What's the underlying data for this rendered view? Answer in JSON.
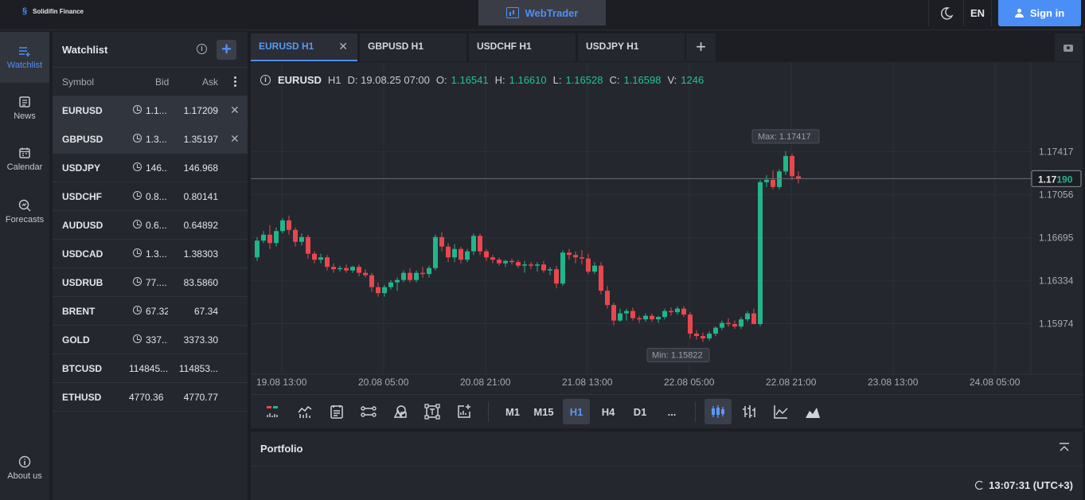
{
  "brand": {
    "name": "Solidifin Finance"
  },
  "header": {
    "center_tab": "WebTrader",
    "language": "EN",
    "sign_in": "Sign in"
  },
  "nav": [
    {
      "label": "Watchlist",
      "icon": "watchlist-icon"
    },
    {
      "label": "News",
      "icon": "news-icon"
    },
    {
      "label": "Calendar",
      "icon": "calendar-icon"
    },
    {
      "label": "Forecasts",
      "icon": "forecasts-icon"
    },
    {
      "label": "About us",
      "icon": "info-icon"
    }
  ],
  "watchlist": {
    "title": "Watchlist",
    "columns": {
      "symbol": "Symbol",
      "bid": "Bid",
      "ask": "Ask"
    },
    "rows": [
      {
        "symbol": "EURUSD",
        "bid": "1.1...",
        "ask": "1.17209",
        "clock": true,
        "removable": true
      },
      {
        "symbol": "GBPUSD",
        "bid": "1.3...",
        "ask": "1.35197",
        "clock": true,
        "removable": true
      },
      {
        "symbol": "USDJPY",
        "bid": "146...",
        "ask": "146.968",
        "clock": true
      },
      {
        "symbol": "USDCHF",
        "bid": "0.8...",
        "ask": "0.80141",
        "clock": true
      },
      {
        "symbol": "AUDUSD",
        "bid": "0.6...",
        "ask": "0.64892",
        "clock": true
      },
      {
        "symbol": "USDCAD",
        "bid": "1.3...",
        "ask": "1.38303",
        "clock": true
      },
      {
        "symbol": "USDRUB",
        "bid": "77....",
        "ask": "83.5860",
        "clock": true
      },
      {
        "symbol": "BRENT",
        "bid": "67.32",
        "ask": "67.34",
        "clock": true
      },
      {
        "symbol": "GOLD",
        "bid": "337...",
        "ask": "3373.30",
        "clock": true
      },
      {
        "symbol": "BTCUSD",
        "bid": "114845...",
        "ask": "114853...",
        "clock": false
      },
      {
        "symbol": "ETHUSD",
        "bid": "4770.36",
        "ask": "4770.77",
        "clock": false
      }
    ]
  },
  "tabs": [
    "EURUSD H1",
    "GBPUSD H1",
    "USDCHF H1",
    "USDJPY H1"
  ],
  "ohlc": {
    "pair": "EURUSD",
    "tf": "H1",
    "date_label": "D: 19.08.25 07:00",
    "o_label": "O:",
    "o": "1.16541",
    "h_label": "H:",
    "h": "1.16610",
    "l_label": "L:",
    "l": "1.16528",
    "c_label": "C:",
    "c": "1.16598",
    "v_label": "V:",
    "v": "1246"
  },
  "colors": {
    "up": "#22b58a",
    "down": "#e9474e",
    "accent": "#4f8ff7"
  },
  "timeframes": [
    "M1",
    "M15",
    "H1",
    "H4",
    "D1",
    "..."
  ],
  "selected_timeframe": "H1",
  "portfolio": {
    "title": "Portfolio",
    "clock": "13:07:31 (UTC+3)"
  },
  "chart_data": {
    "type": "candlestick",
    "symbol": "EURUSD",
    "timeframe": "H1",
    "x_ticks": [
      "19.08 13:00",
      "20.08 05:00",
      "20.08 21:00",
      "21.08 13:00",
      "22.08 05:00",
      "22.08 21:00",
      "23.08 13:00",
      "24.08 05:00"
    ],
    "y_ticks": [
      "1.17417",
      "1.17056",
      "1.16695",
      "1.16334",
      "1.15974"
    ],
    "ylim": [
      1.1555,
      1.179
    ],
    "current_price": {
      "prefix": "1.17",
      "suffix": "190",
      "value": 1.1719
    },
    "max_label": "Max: 1.17417",
    "min_label": "Min: 1.15822",
    "candles": [
      [
        1.1653,
        1.167,
        1.165,
        1.1667
      ],
      [
        1.1667,
        1.1675,
        1.1665,
        1.1672
      ],
      [
        1.1672,
        1.168,
        1.166,
        1.1665
      ],
      [
        1.1665,
        1.1678,
        1.1662,
        1.1675
      ],
      [
        1.1675,
        1.1686,
        1.1673,
        1.1684
      ],
      [
        1.1684,
        1.1688,
        1.1672,
        1.1676
      ],
      [
        1.1676,
        1.1678,
        1.1662,
        1.1666
      ],
      [
        1.1666,
        1.1673,
        1.1663,
        1.167
      ],
      [
        1.167,
        1.1672,
        1.1652,
        1.1656
      ],
      [
        1.1656,
        1.1658,
        1.1648,
        1.1651
      ],
      [
        1.1651,
        1.1656,
        1.1648,
        1.1653
      ],
      [
        1.1653,
        1.1655,
        1.1642,
        1.1645
      ],
      [
        1.1645,
        1.1648,
        1.164,
        1.1643
      ],
      [
        1.1643,
        1.1646,
        1.1641,
        1.1644
      ],
      [
        1.1644,
        1.1647,
        1.164,
        1.1642
      ],
      [
        1.1642,
        1.1646,
        1.164,
        1.1645
      ],
      [
        1.1645,
        1.1647,
        1.1637,
        1.164
      ],
      [
        1.164,
        1.1643,
        1.1636,
        1.1638
      ],
      [
        1.1638,
        1.164,
        1.1624,
        1.1628
      ],
      [
        1.1628,
        1.1632,
        1.162,
        1.1623
      ],
      [
        1.1623,
        1.163,
        1.162,
        1.1628
      ],
      [
        1.1628,
        1.1634,
        1.1626,
        1.1632
      ],
      [
        1.1632,
        1.1636,
        1.1625,
        1.1634
      ],
      [
        1.1634,
        1.1642,
        1.1632,
        1.164
      ],
      [
        1.164,
        1.1644,
        1.1632,
        1.1634
      ],
      [
        1.1634,
        1.1642,
        1.1632,
        1.164
      ],
      [
        1.164,
        1.1645,
        1.1636,
        1.1639
      ],
      [
        1.1639,
        1.1646,
        1.1636,
        1.1644
      ],
      [
        1.1644,
        1.1672,
        1.1642,
        1.167
      ],
      [
        1.167,
        1.1674,
        1.1658,
        1.1662
      ],
      [
        1.1662,
        1.1665,
        1.1649,
        1.1653
      ],
      [
        1.1653,
        1.1664,
        1.1649,
        1.166
      ],
      [
        1.166,
        1.1662,
        1.1648,
        1.1651
      ],
      [
        1.1651,
        1.166,
        1.1649,
        1.1658
      ],
      [
        1.1658,
        1.1673,
        1.1655,
        1.1671
      ],
      [
        1.1671,
        1.1673,
        1.1655,
        1.1658
      ],
      [
        1.1658,
        1.166,
        1.165,
        1.1653
      ],
      [
        1.1653,
        1.1655,
        1.1648,
        1.1651
      ],
      [
        1.1651,
        1.1653,
        1.1646,
        1.1648
      ],
      [
        1.1648,
        1.1651,
        1.1645,
        1.165
      ],
      [
        1.165,
        1.1652,
        1.1647,
        1.1649
      ],
      [
        1.1649,
        1.1651,
        1.1644,
        1.1646
      ],
      [
        1.1646,
        1.165,
        1.164,
        1.1647
      ],
      [
        1.1647,
        1.1649,
        1.1643,
        1.1646
      ],
      [
        1.1646,
        1.1649,
        1.1641,
        1.1647
      ],
      [
        1.1647,
        1.165,
        1.164,
        1.1642
      ],
      [
        1.1642,
        1.1645,
        1.1638,
        1.1643
      ],
      [
        1.1643,
        1.1646,
        1.1627,
        1.1631
      ],
      [
        1.1631,
        1.1659,
        1.1629,
        1.1657
      ],
      [
        1.1657,
        1.166,
        1.1651,
        1.1655
      ],
      [
        1.1655,
        1.1658,
        1.1648,
        1.1653
      ],
      [
        1.1653,
        1.1659,
        1.1647,
        1.1652
      ],
      [
        1.1652,
        1.1656,
        1.1639,
        1.1641
      ],
      [
        1.1641,
        1.1649,
        1.1639,
        1.1646
      ],
      [
        1.1646,
        1.1649,
        1.1622,
        1.1625
      ],
      [
        1.1625,
        1.1629,
        1.161,
        1.1613
      ],
      [
        1.1613,
        1.1615,
        1.1596,
        1.16
      ],
      [
        1.16,
        1.161,
        1.1599,
        1.1606
      ],
      [
        1.1606,
        1.161,
        1.16,
        1.1608
      ],
      [
        1.1608,
        1.1611,
        1.16,
        1.1602
      ],
      [
        1.1602,
        1.1604,
        1.1598,
        1.1601
      ],
      [
        1.1601,
        1.1606,
        1.1599,
        1.1604
      ],
      [
        1.1604,
        1.1606,
        1.1599,
        1.1601
      ],
      [
        1.1601,
        1.1604,
        1.1598,
        1.1603
      ],
      [
        1.1603,
        1.161,
        1.1601,
        1.1608
      ],
      [
        1.1608,
        1.1611,
        1.1604,
        1.1607
      ],
      [
        1.1607,
        1.1612,
        1.1605,
        1.161
      ],
      [
        1.161,
        1.1612,
        1.1603,
        1.1605
      ],
      [
        1.1605,
        1.1607,
        1.1585,
        1.1589
      ],
      [
        1.1589,
        1.1592,
        1.1584,
        1.1587
      ],
      [
        1.1587,
        1.159,
        1.1582,
        1.1585
      ],
      [
        1.1585,
        1.1591,
        1.1583,
        1.1589
      ],
      [
        1.1589,
        1.1595,
        1.1587,
        1.1594
      ],
      [
        1.1594,
        1.16,
        1.1592,
        1.1598
      ],
      [
        1.1598,
        1.1602,
        1.1595,
        1.1597
      ],
      [
        1.1597,
        1.16,
        1.1593,
        1.1595
      ],
      [
        1.1595,
        1.1603,
        1.1593,
        1.1601
      ],
      [
        1.1601,
        1.1608,
        1.1599,
        1.1606
      ],
      [
        1.1606,
        1.161,
        1.1599,
        1.1597
      ],
      [
        1.1597,
        1.1718,
        1.1595,
        1.1716
      ],
      [
        1.1716,
        1.1722,
        1.1712,
        1.1718
      ],
      [
        1.1718,
        1.1726,
        1.171,
        1.1712
      ],
      [
        1.1712,
        1.1727,
        1.171,
        1.1725
      ],
      [
        1.1725,
        1.1742,
        1.1722,
        1.1738
      ],
      [
        1.1738,
        1.174,
        1.1718,
        1.1721
      ],
      [
        1.1721,
        1.1725,
        1.1715,
        1.1719
      ]
    ]
  }
}
